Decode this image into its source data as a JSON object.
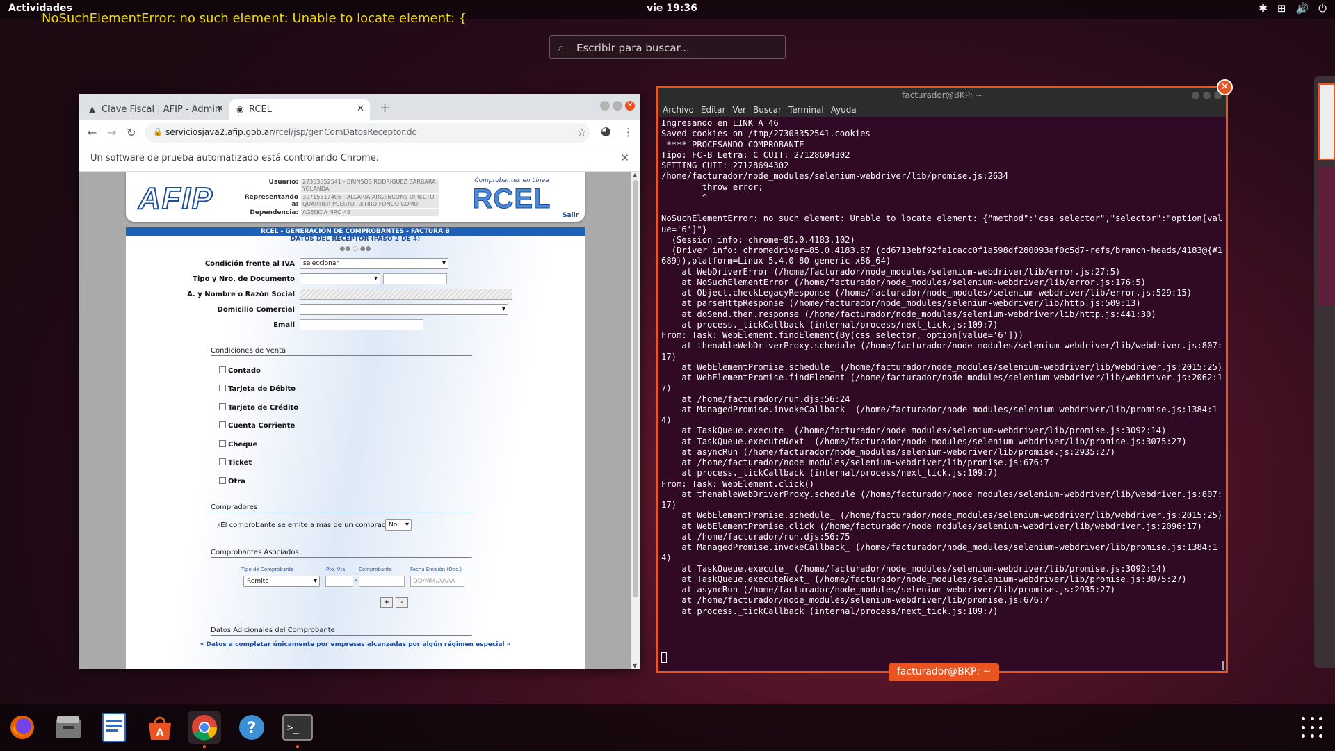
{
  "topbar": {
    "activities": "Actividades",
    "clock": "vie 19:36",
    "tray": [
      "bluetooth-icon",
      "network-icon",
      "volume-icon",
      "power-icon"
    ]
  },
  "error_tooltip": "NoSuchElementError: no such element: Unable to locate element: {",
  "search": {
    "placeholder": "Escribir para buscar..."
  },
  "chrome": {
    "tabs": [
      {
        "label": "Clave Fiscal | AFIP - Admin"
      },
      {
        "label": "RCEL"
      }
    ],
    "url_host": "serviciosjava2.afip.gob.ar",
    "url_path": "/rcel/jsp/genComDatosReceptor.do",
    "infobar": "Un software de prueba automatizado está controlando Chrome."
  },
  "afip": {
    "logo": "AFIP",
    "usuario_label": "Usuario:",
    "usuario": "27303352541 - BRINSOS RODRIGUEZ BARBARA YOLANDA",
    "representando_label": "Representando a:",
    "representando": "30715517406 - ALLARIA ARGENCONS DIRECTO QUARTIER PUERTO RETIRO FONDO COMU",
    "dependencia_label": "Dependencia:",
    "dependencia": "AGENCIA NRO 49",
    "rcel_caption": "Comprobantes en Línea",
    "rcel_logo": "RCEL",
    "salir": "Salir"
  },
  "form": {
    "title": "RCEL - GENERACIÓN DE COMPROBANTES - FACTURA B",
    "subtitle": "DATOS DEL RECEPTOR (PASO 2 DE 4)",
    "steps": "●● ○ ●●",
    "iva_label": "Condición frente al IVA",
    "iva_value": "seleccionar...",
    "doc_label": "Tipo y Nro. de Documento",
    "nombre_label": "A. y Nombre o Razón Social",
    "domicilio_label": "Domicilio Comercial",
    "email_label": "Email",
    "venta_section": "Condiciones de Venta",
    "venta": [
      "Contado",
      "Tarjeta de Débito",
      "Tarjeta de Crédito",
      "Cuenta Corriente",
      "Cheque",
      "Ticket",
      "Otra"
    ],
    "compradores_section": "Compradores",
    "compradores_q": "¿El comprobante se emite a más de un comprador?",
    "compradores_value": "No",
    "asociados_section": "Comprobantes Asociados",
    "asoc_cols": [
      "Tipo de Comprobante",
      "Pto. Vta.",
      "Comprobante",
      "Fecha Emisión (Opc.)"
    ],
    "asoc_tipo": "Remito",
    "asoc_dash": "-",
    "asoc_fecha_ph": "DD/MM/AAAA",
    "plus": "+",
    "minus": "-",
    "adicionales_section": "Datos Adicionales del Comprobante",
    "adicionales_link": "» Datos a completar únicamente por empresas alcanzadas por algún régimen especial «"
  },
  "terminal": {
    "title": "facturador@BKP: ~",
    "menu": [
      "Archivo",
      "Editar",
      "Ver",
      "Buscar",
      "Terminal",
      "Ayuda"
    ],
    "output": "Ingresando en LINK A 46\nSaved cookies on /tmp/27303352541.cookies\n **** PROCESANDO COMPROBANTE\nTipo: FC-B Letra: C CUIT: 27128694302\nSETTING CUIT: 27128694302\n/home/facturador/node_modules/selenium-webdriver/lib/promise.js:2634\n        throw error;\n        ^\n\nNoSuchElementError: no such element: Unable to locate element: {\"method\":\"css selector\",\"selector\":\"option[value='6']\"}\n  (Session info: chrome=85.0.4183.102)\n  (Driver info: chromedriver=85.0.4183.87 (cd6713ebf92fa1cacc0f1a598df280093af0c5d7-refs/branch-heads/4183@{#1689}),platform=Linux 5.4.0-80-generic x86_64)\n    at WebDriverError (/home/facturador/node_modules/selenium-webdriver/lib/error.js:27:5)\n    at NoSuchElementError (/home/facturador/node_modules/selenium-webdriver/lib/error.js:176:5)\n    at Object.checkLegacyResponse (/home/facturador/node_modules/selenium-webdriver/lib/error.js:529:15)\n    at parseHttpResponse (/home/facturador/node_modules/selenium-webdriver/lib/http.js:509:13)\n    at doSend.then.response (/home/facturador/node_modules/selenium-webdriver/lib/http.js:441:30)\n    at process._tickCallback (internal/process/next_tick.js:109:7)\nFrom: Task: WebElement.findElement(By(css selector, option[value='6']))\n    at thenableWebDriverProxy.schedule (/home/facturador/node_modules/selenium-webdriver/lib/webdriver.js:807:17)\n    at WebElementPromise.schedule_ (/home/facturador/node_modules/selenium-webdriver/lib/webdriver.js:2015:25)\n    at WebElementPromise.findElement (/home/facturador/node_modules/selenium-webdriver/lib/webdriver.js:2062:17)\n    at /home/facturador/run.djs:56:24\n    at ManagedPromise.invokeCallback_ (/home/facturador/node_modules/selenium-webdriver/lib/promise.js:1384:14)\n    at TaskQueue.execute_ (/home/facturador/node_modules/selenium-webdriver/lib/promise.js:3092:14)\n    at TaskQueue.executeNext_ (/home/facturador/node_modules/selenium-webdriver/lib/promise.js:3075:27)\n    at asyncRun (/home/facturador/node_modules/selenium-webdriver/lib/promise.js:2935:27)\n    at /home/facturador/node_modules/selenium-webdriver/lib/promise.js:676:7\n    at process._tickCallback (internal/process/next_tick.js:109:7)\nFrom: Task: WebElement.click()\n    at thenableWebDriverProxy.schedule (/home/facturador/node_modules/selenium-webdriver/lib/webdriver.js:807:17)\n    at WebElementPromise.schedule_ (/home/facturador/node_modules/selenium-webdriver/lib/webdriver.js:2015:25)\n    at WebElementPromise.click (/home/facturador/node_modules/selenium-webdriver/lib/webdriver.js:2096:17)\n    at /home/facturador/run.djs:56:75\n    at ManagedPromise.invokeCallback_ (/home/facturador/node_modules/selenium-webdriver/lib/promise.js:1384:14)\n    at TaskQueue.execute_ (/home/facturador/node_modules/selenium-webdriver/lib/promise.js:3092:14)\n    at TaskQueue.executeNext_ (/home/facturador/node_modules/selenium-webdriver/lib/promise.js:3075:27)\n    at asyncRun (/home/facturador/node_modules/selenium-webdriver/lib/promise.js:2935:27)\n    at /home/facturador/node_modules/selenium-webdriver/lib/promise.js:676:7\n    at process._tickCallback (internal/process/next_tick.js:109:7)",
    "window_label": "facturador@BKP: ~"
  },
  "dock": {
    "apps": [
      "firefox-icon",
      "files-icon",
      "writer-icon",
      "software-icon",
      "chrome-icon",
      "help-icon",
      "terminal-icon"
    ]
  },
  "colors": {
    "accent": "#e95420",
    "terminal_bg": "#300a24",
    "afip_blue": "#1e5fb8"
  }
}
